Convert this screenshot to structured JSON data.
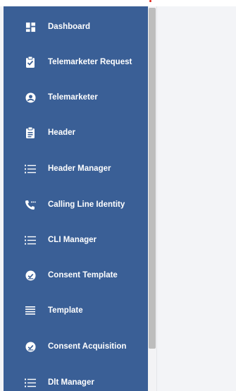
{
  "sidebar": {
    "items": [
      {
        "label": "Dashboard",
        "icon": "dashboard-icon"
      },
      {
        "label": "Telemarketer Request",
        "icon": "clipboard-check-icon"
      },
      {
        "label": "Telemarketer",
        "icon": "account-circle-icon"
      },
      {
        "label": "Header",
        "icon": "clipboard-text-icon"
      },
      {
        "label": "Header Manager",
        "icon": "list-icon"
      },
      {
        "label": "Calling Line Identity",
        "icon": "phone-icon"
      },
      {
        "label": "CLI Manager",
        "icon": "list-icon"
      },
      {
        "label": "Consent Template",
        "icon": "check-circle-icon"
      },
      {
        "label": "Template",
        "icon": "lines-icon"
      },
      {
        "label": "Consent Acquisition",
        "icon": "check-circle-icon"
      },
      {
        "label": "Dlt Manager",
        "icon": "list-icon"
      }
    ]
  },
  "colors": {
    "sidebar_bg": "#3a5f96",
    "text": "#ffffff",
    "brand_accent": "#e0261b"
  }
}
